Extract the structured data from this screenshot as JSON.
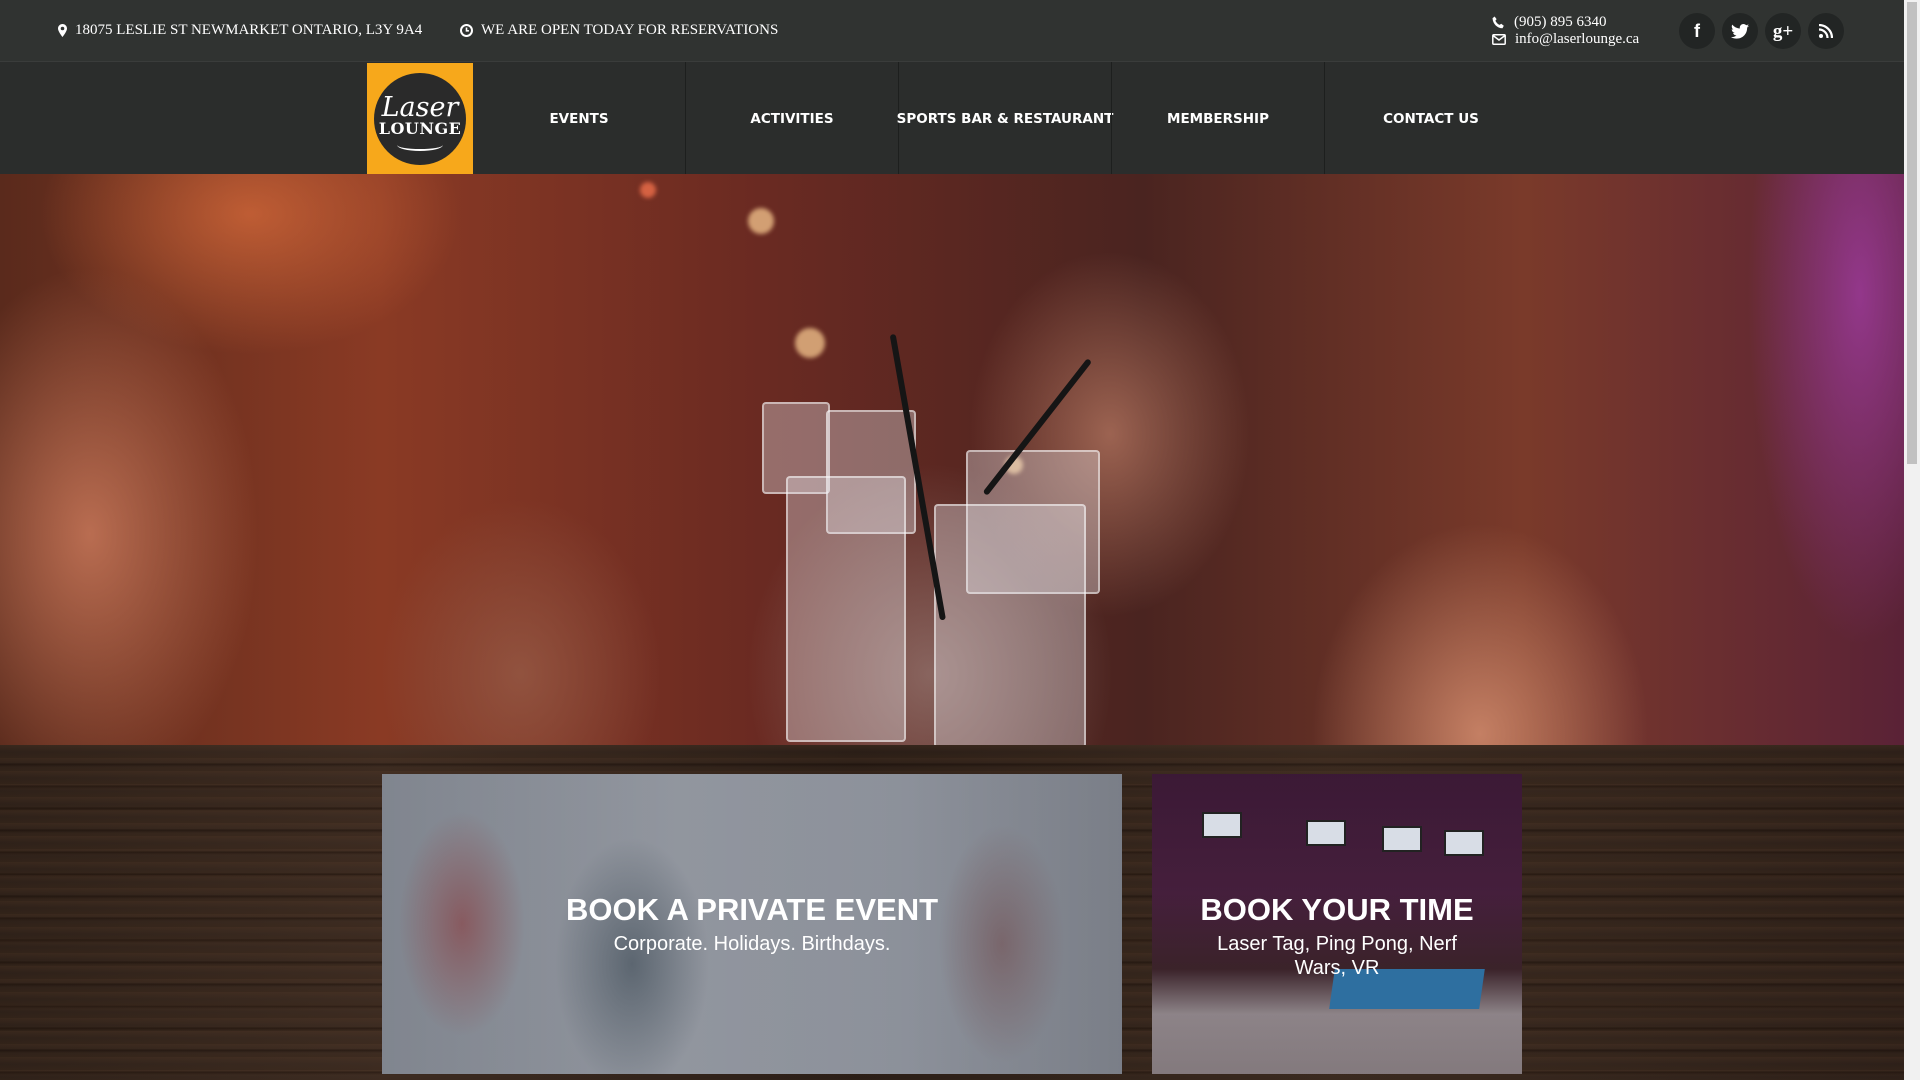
{
  "topbar": {
    "address": "18075 LESLIE ST NEWMARKET ONTARIO, L3Y 9A4",
    "hours": "WE ARE OPEN TODAY FOR RESERVATIONS",
    "phone": "(905) 895 6340",
    "email": "info@laserlounge.ca",
    "social": {
      "facebook": "f",
      "twitter": "t",
      "googleplus": "g+",
      "rss": "rss"
    }
  },
  "logo": {
    "line1": "Laser",
    "line2": "LOUNGE"
  },
  "nav": {
    "items": [
      {
        "label": "EVENTS"
      },
      {
        "label": "ACTIVITIES"
      },
      {
        "label": "SPORTS BAR & RESTAURANT"
      },
      {
        "label": "MEMBERSHIP"
      },
      {
        "label": "CONTACT US"
      }
    ]
  },
  "hero": {
    "image_description_icon": "people-toasting-drinks-photo"
  },
  "cards": {
    "private_event": {
      "title": "BOOK A PRIVATE EVENT",
      "subtitle": "Corporate. Holidays. Birthdays."
    },
    "book_time": {
      "title": "BOOK YOUR TIME",
      "subtitle": "Laser Tag, Ping Pong, Nerf Wars, VR"
    }
  },
  "colors": {
    "topbar_bg": "#303331",
    "nav_bg": "#2b2d2c",
    "logo_accent": "#f7a81b",
    "text": "#ffffff"
  }
}
